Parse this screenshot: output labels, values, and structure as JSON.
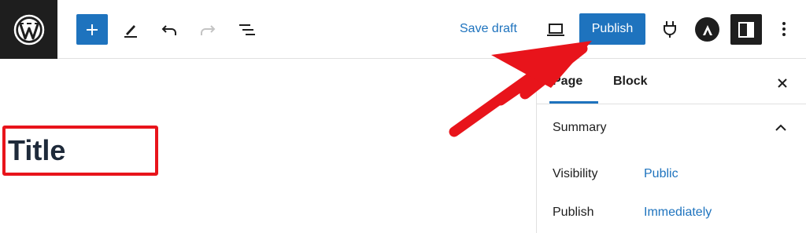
{
  "toolbar": {
    "save_draft": "Save draft",
    "publish": "Publish"
  },
  "editor": {
    "title": "Title"
  },
  "sidebar": {
    "tabs": [
      {
        "label": "Page",
        "active": true
      },
      {
        "label": "Block",
        "active": false
      }
    ],
    "summary_heading": "Summary",
    "rows": [
      {
        "label": "Visibility",
        "value": "Public"
      },
      {
        "label": "Publish",
        "value": "Immediately"
      }
    ]
  },
  "colors": {
    "accent": "#1e73be",
    "dark": "#1e1e1e",
    "annotation": "#e8141b"
  },
  "icons": [
    "wordpress-logo-icon",
    "plus-icon",
    "pencil-icon",
    "undo-icon",
    "redo-icon",
    "list-view-icon",
    "desktop-preview-icon",
    "plugin-icon",
    "astra-icon",
    "sidebar-settings-icon",
    "more-options-icon",
    "close-icon",
    "chevron-up-icon"
  ]
}
